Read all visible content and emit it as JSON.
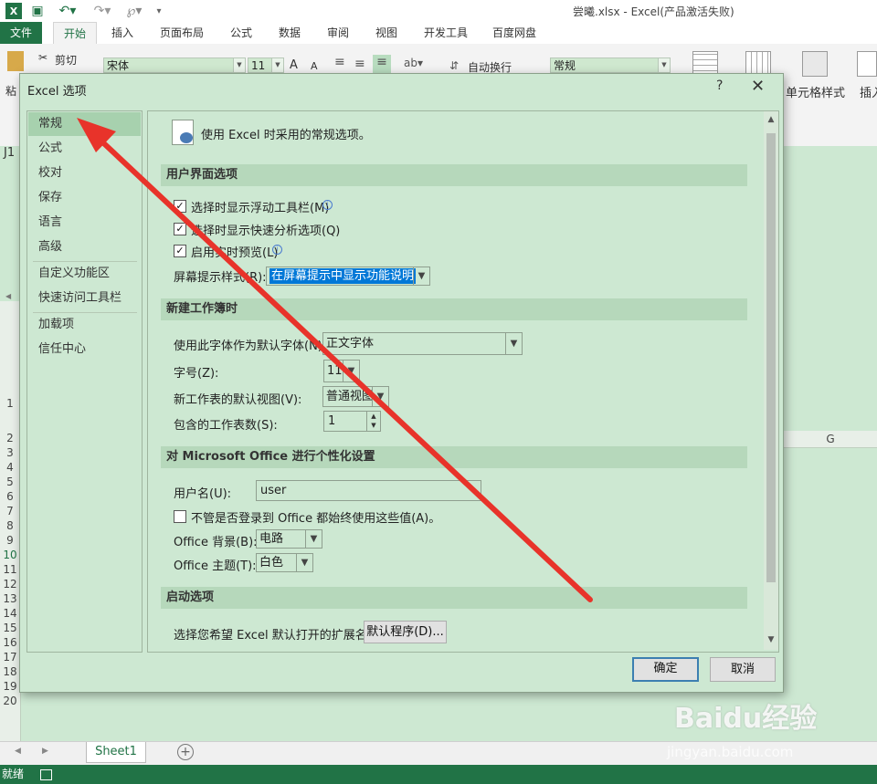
{
  "app": {
    "window_title": "尝曦.xlsx - Excel(产品激活失败)",
    "tabs": [
      "文件",
      "开始",
      "插入",
      "页面布局",
      "公式",
      "数据",
      "审阅",
      "视图",
      "开发工具",
      "百度网盘"
    ]
  },
  "ribbon": {
    "cut": "剪切",
    "paste": "粘",
    "font_name": "宋体",
    "font_size": "11",
    "font_grow": "A",
    "font_shrink": "A",
    "wrap_text": "自动换行",
    "number_format": "常规",
    "cell_styles": "单元格样式",
    "insert": "插入"
  },
  "sheet": {
    "name_box_partial": "J1",
    "column_g": "G",
    "rows": [
      "1",
      "2",
      "3",
      "4",
      "5",
      "6",
      "7",
      "8",
      "9",
      "10",
      "11",
      "12",
      "13",
      "14",
      "15",
      "16",
      "17",
      "18",
      "19",
      "20"
    ],
    "selected_row": "10",
    "tab_name": "Sheet1",
    "add_sheet": "+",
    "status": "就绪"
  },
  "watermark": {
    "main": "Baidu经验",
    "sub": "jingyan.baidu.com"
  },
  "dialog": {
    "title": "Excel 选项",
    "help": "?",
    "close": "✕",
    "nav": [
      "常规",
      "公式",
      "校对",
      "保存",
      "语言",
      "高级",
      "自定义功能区",
      "快速访问工具栏",
      "加载项",
      "信任中心"
    ],
    "intro": "使用 Excel 时采用的常规选项。",
    "sections": {
      "ui": "用户界面选项",
      "new_wb": "新建工作簿时",
      "personalize": "对 Microsoft Office 进行个性化设置",
      "startup": "启动选项"
    },
    "ui": {
      "mini_toolbar": "选择时显示浮动工具栏(M)",
      "quick_analysis": "选择时显示快速分析选项(Q)",
      "live_preview": "启用实时预览(L)",
      "screentip_label": "屏幕提示样式(R):",
      "screentip_value": "在屏幕提示中显示功能说明"
    },
    "new_wb": {
      "font_label": "使用此字体作为默认字体(N):",
      "font_value": "正文字体",
      "size_label": "字号(Z):",
      "size_value": "11",
      "view_label": "新工作表的默认视图(V):",
      "view_value": "普通视图",
      "sheets_label": "包含的工作表数(S):",
      "sheets_value": "1"
    },
    "personalize": {
      "username_label": "用户名(U):",
      "username_value": "user",
      "always_use": "不管是否登录到 Office 都始终使用这些值(A)。",
      "background_label": "Office 背景(B):",
      "background_value": "电路",
      "theme_label": "Office 主题(T):",
      "theme_value": "白色"
    },
    "startup": {
      "ext_label": "选择您希望 Excel 默认打开的扩展名:",
      "default_programs": "默认程序(D)..."
    },
    "ok": "确定",
    "cancel": "取消"
  },
  "colors": {
    "excel_green": "#217346",
    "arrow": "#e8332a"
  }
}
